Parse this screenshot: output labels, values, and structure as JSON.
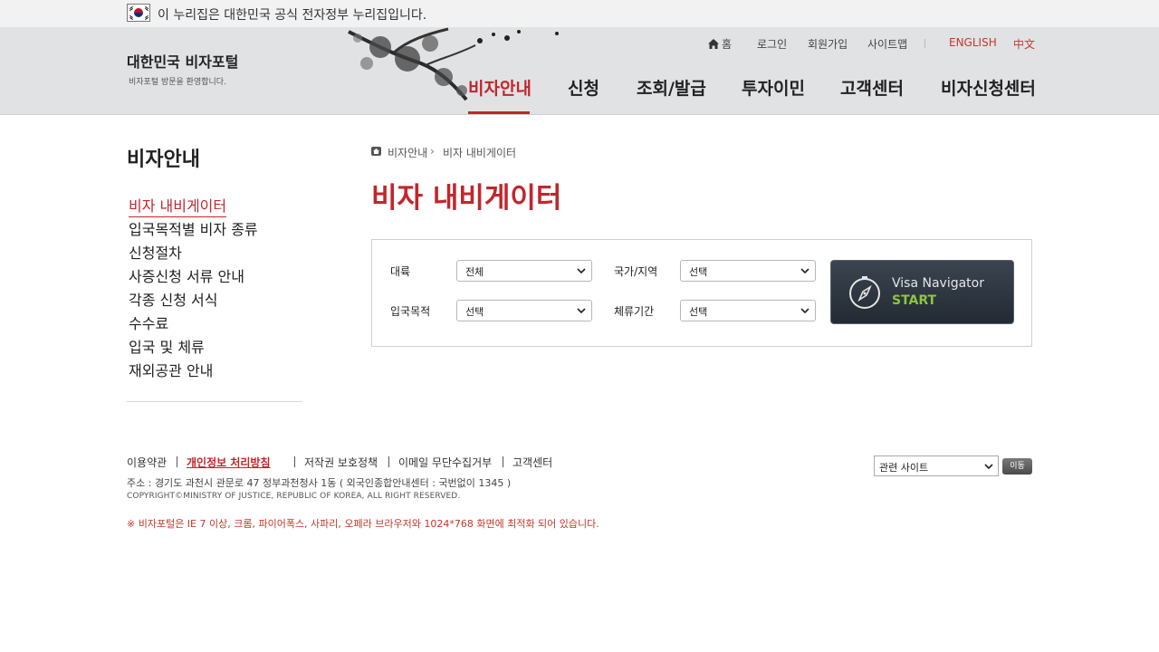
{
  "gov_banner": {
    "text": "이 누리집은 대한민국 공식 전자정부 누리집입니다."
  },
  "brand": {
    "title": "대한민국 비자포털",
    "subtitle": "비자포털 방문을 환영합니다."
  },
  "utility_nav": {
    "home": "홈",
    "login": "로그인",
    "signup": "회원가입",
    "sitemap": "사이트맵",
    "english": "ENGLISH",
    "chinese": "中文"
  },
  "gnb": [
    "비자안내",
    "신청",
    "조회/발급",
    "투자이민",
    "고객센터",
    "비자신청센터"
  ],
  "lnb": {
    "title": "비자안내",
    "items": [
      "비자 내비게이터",
      "입국목적별 비자 종류",
      "신청절차",
      "사증신청 서류 안내",
      "각종 신청 서식",
      "수수료",
      "입국 및 체류",
      "재외공관 안내"
    ]
  },
  "breadcrumb": [
    "비자안내",
    "비자 내비게이터"
  ],
  "page_title": "비자 내비게이터",
  "search": {
    "category_label": "대륙",
    "category_value": "전체",
    "country_label": "국가/지역",
    "country_value": "선택",
    "purpose_label": "입국목적",
    "purpose_value": "선택",
    "stay_label": "체류기간",
    "stay_value": "선택"
  },
  "visa_button": {
    "title": "Visa Navigator",
    "start": "START"
  },
  "footer": {
    "links": [
      "이용약관",
      "개인정보 처리방침",
      "저작권 보호정책",
      "이메일 무단수집거부",
      "고객센터"
    ],
    "address": "주소 : 경기도 과천시 관문로 47 정부과천청사 1동 ( 외국인종합안내센터 : 국번없이 1345 )",
    "copyright": "COPYRIGHT©MINISTRY OF JUSTICE, REPUBLIC OF KOREA, ALL RIGHT RESERVED.",
    "notice": "※ 비자포털은 IE 7 이상, 크롬, 파이어폭스, 사파리, 오페라 브라우저와 1024*768 화면에 최적화 되어 있습니다.",
    "related_site": "관련 사이트",
    "go_label": "이동"
  },
  "colors": {
    "accent": "#c0272d",
    "header_bg": "#e1e2e4",
    "start_green": "#8cc63f"
  }
}
